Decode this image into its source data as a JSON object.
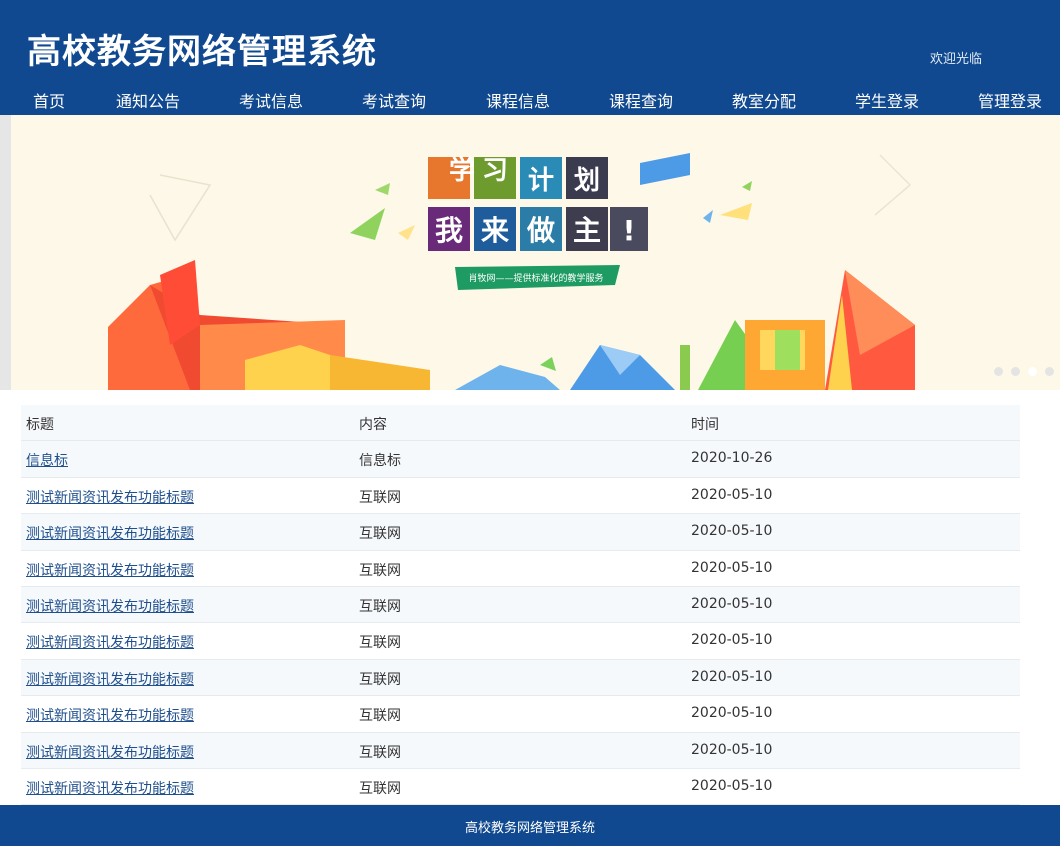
{
  "site": {
    "title": "高校教务网络管理系统",
    "welcome": "欢迎光临"
  },
  "nav": [
    {
      "label": "首页"
    },
    {
      "label": "通知公告"
    },
    {
      "label": "考试信息"
    },
    {
      "label": "考试查询"
    },
    {
      "label": "课程信息"
    },
    {
      "label": "课程查询"
    },
    {
      "label": "教室分配"
    },
    {
      "label": "学生登录"
    },
    {
      "label": "管理登录"
    }
  ],
  "banner": {
    "line1": [
      "学",
      "习",
      "计",
      "划"
    ],
    "line2": [
      "我",
      "来",
      "做",
      "主",
      "!"
    ],
    "tagline": "肖牧网——提供标准化的教学服务",
    "slides": 4,
    "active_slide": 3
  },
  "table": {
    "headers": [
      "标题",
      "内容",
      "时间"
    ],
    "rows": [
      {
        "title": "信息标",
        "content": "信息标",
        "time": "2020-10-26"
      },
      {
        "title": "测试新闻资讯发布功能标题",
        "content": "互联网",
        "time": "2020-05-10"
      },
      {
        "title": "测试新闻资讯发布功能标题",
        "content": "互联网",
        "time": "2020-05-10"
      },
      {
        "title": "测试新闻资讯发布功能标题",
        "content": "互联网",
        "time": "2020-05-10"
      },
      {
        "title": "测试新闻资讯发布功能标题",
        "content": "互联网",
        "time": "2020-05-10"
      },
      {
        "title": "测试新闻资讯发布功能标题",
        "content": "互联网",
        "time": "2020-05-10"
      },
      {
        "title": "测试新闻资讯发布功能标题",
        "content": "互联网",
        "time": "2020-05-10"
      },
      {
        "title": "测试新闻资讯发布功能标题",
        "content": "互联网",
        "time": "2020-05-10"
      },
      {
        "title": "测试新闻资讯发布功能标题",
        "content": "互联网",
        "time": "2020-05-10"
      },
      {
        "title": "测试新闻资讯发布功能标题",
        "content": "互联网",
        "time": "2020-05-10"
      }
    ]
  },
  "footer": {
    "text": "高校教务网络管理系统"
  },
  "colors": {
    "brand": "#10498f",
    "link": "#1f4f8c",
    "banner_bg": "#fdf8e7"
  }
}
